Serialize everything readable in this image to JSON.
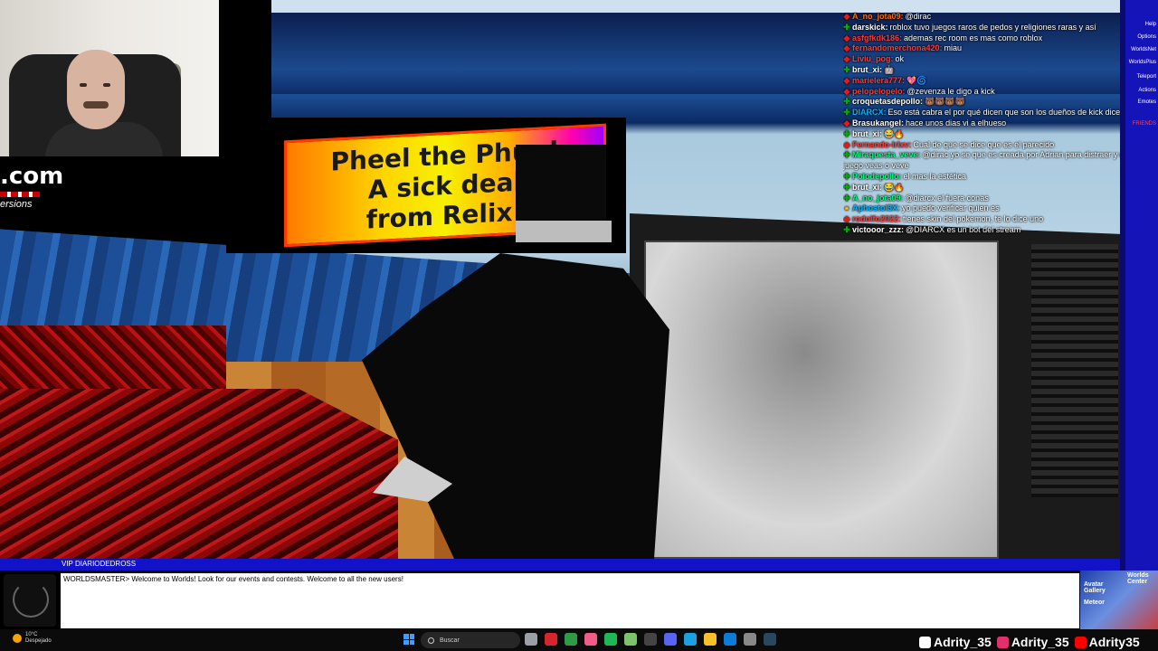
{
  "game": {
    "sign_lines": [
      "Pheel the Phun!",
      "A sick deal",
      "from Relix!"
    ]
  },
  "brand_overlay": {
    "text": ".com",
    "subtext": "ersions"
  },
  "chat_messages": [
    {
      "badge": "vip",
      "user": "A_no_jota09",
      "user_color": "#ff6a00",
      "text": "@dirac"
    },
    {
      "badge": "mod",
      "user": "darskick",
      "user_color": "#ffffff",
      "text": "roblox tuvo juegos raros de pedos y religiones raras y así"
    },
    {
      "badge": "vip",
      "user": "asfgfkdk186",
      "user_color": "#ff3b3b",
      "text": "ademas rec room es mas como roblox"
    },
    {
      "badge": "vip",
      "user": "fernandomerchona420",
      "user_color": "#ff3b3b",
      "text": "miau"
    },
    {
      "badge": "vip",
      "user": "Liviu_pog",
      "user_color": "#ff3b3b",
      "text": "ok"
    },
    {
      "badge": "mod",
      "user": "brut_xi",
      "user_color": "#ffffff",
      "text": "🤖"
    },
    {
      "badge": "vip",
      "user": "marielera777",
      "user_color": "#ff3b3b",
      "text": "💖🌀"
    },
    {
      "badge": "vip",
      "user": "pelopelopelo",
      "user_color": "#ff3b3b",
      "text": "@zevenza le digo a kick"
    },
    {
      "badge": "mod",
      "user": "croquetasdepollo",
      "user_color": "#ffffff",
      "text": "🐻🐻🐻🐻"
    },
    {
      "badge": "mod",
      "user": "DIARCX",
      "user_color": "#00b5ff",
      "text": "Eso está cabra el por qué dicen que son los dueños de kick dice cosas",
      "wrap": true
    },
    {
      "badge": "vip",
      "user": "Brasukangel",
      "user_color": "#ffffff",
      "text": "hace unos dias vi a elhueso"
    },
    {
      "badge": "mod",
      "user": "brut_xi",
      "user_color": "#ffffff",
      "text": "😂🔥"
    },
    {
      "badge": "vip",
      "user": "Fernando-Irlxv",
      "user_color": "#ff3b3b",
      "text": "Cual de que se dice que es el parecido"
    },
    {
      "badge": "mod",
      "user": "Miraquesta_veve",
      "user_color": "#00ff7f",
      "text": "@dirac yo se que es creada por Adrian para distraer y que juego veas o veve",
      "wrap": true
    },
    {
      "badge": "mod",
      "user": "Polodepollo",
      "user_color": "#00ff7f",
      "text": "el mas la estética"
    },
    {
      "badge": "mod",
      "user": "brut_xi",
      "user_color": "#ffffff",
      "text": "😂🔥"
    },
    {
      "badge": "mod",
      "user": "A_no_jota09",
      "user_color": "#00ff7f",
      "text": "@diarcx el fuera conas"
    },
    {
      "badge": "sub",
      "user": "Aphostol3X",
      "user_color": "#00b5ff",
      "text": "yo puedo verificar quien es"
    },
    {
      "badge": "vip",
      "user": "rodolfo2022",
      "user_color": "#ff3b3b",
      "text": "tienes skin del pokemon, te lo dice uno"
    },
    {
      "badge": "mod",
      "user": "victooor_zzz",
      "user_color": "#ffffff",
      "text": "@DIARCX es un bot del stream"
    }
  ],
  "side_menu": {
    "items": [
      "Help",
      "Options",
      "WorldsNet",
      "WorldsPlus",
      "Teleport",
      "Actions",
      "Emotes",
      "FRIENDS"
    ]
  },
  "game_chat": {
    "header_label": "VIP DIARIODEDROSS",
    "messages": [
      "WORLDSMASTER> Welcome to Worlds! Look for our events and contests. Welcome to all the new users!"
    ],
    "side_labels": [
      "Worlds Center",
      "Avatar Gallery",
      "Meteor"
    ]
  },
  "taskbar": {
    "weather_temp": "10°C",
    "weather_desc": "Despejado",
    "search_placeholder": "Buscar",
    "apps": [
      {
        "name": "task-view",
        "color": "#9aa0a6"
      },
      {
        "name": "opera",
        "color": "#d6252c"
      },
      {
        "name": "chrome",
        "color": "#2e9b49"
      },
      {
        "name": "notepad",
        "color": "#f25c8a"
      },
      {
        "name": "spotify-like",
        "color": "#1db954"
      },
      {
        "name": "tool",
        "color": "#7cc36a"
      },
      {
        "name": "terminal",
        "color": "#444444"
      },
      {
        "name": "discord",
        "color": "#5865f2"
      },
      {
        "name": "edge",
        "color": "#1ba1e2"
      },
      {
        "name": "files",
        "color": "#f8c12c"
      },
      {
        "name": "edge2",
        "color": "#0f7bd8"
      },
      {
        "name": "settings",
        "color": "#888888"
      },
      {
        "name": "steam",
        "color": "#2a475e"
      }
    ]
  },
  "socials": [
    {
      "platform": "tiktok",
      "handle": "Adrity_35",
      "icon_color": "#ffffff"
    },
    {
      "platform": "instagram",
      "handle": "Adrity_35",
      "icon_color": "#e1306c"
    },
    {
      "platform": "youtube",
      "handle": "Adrity35",
      "icon_color": "#ff0000"
    }
  ]
}
